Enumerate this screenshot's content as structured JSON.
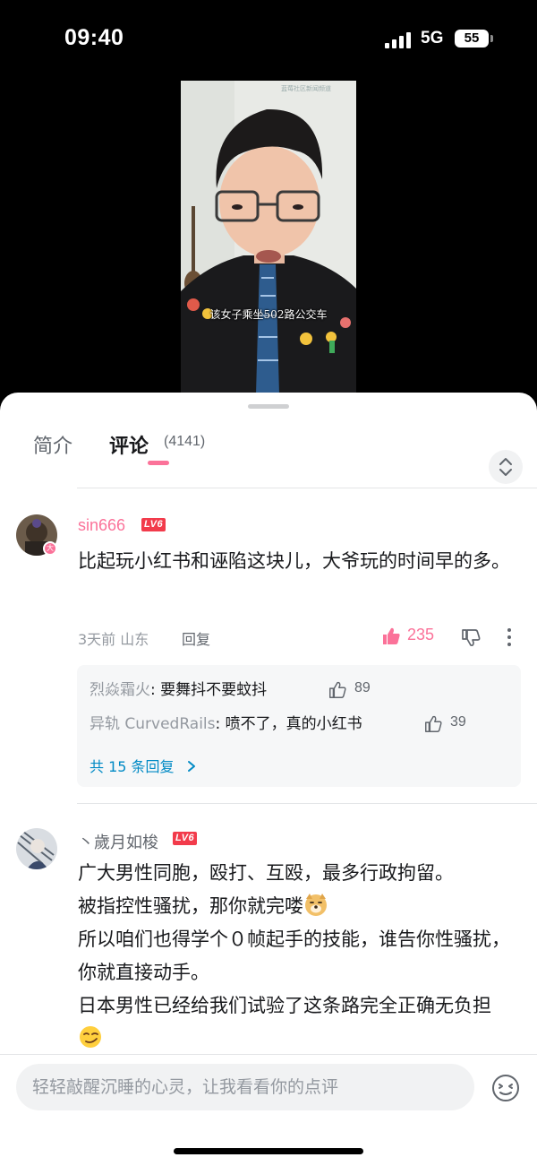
{
  "status_bar": {
    "time": "09:40",
    "network": "5G",
    "battery": "55"
  },
  "video": {
    "subtitle": "该女子乘坐502路公交车",
    "watermark": "蓝莓社区新闻频道"
  },
  "tabs": {
    "intro": "简介",
    "comments": "评论",
    "comment_count": "(4141)"
  },
  "comments": [
    {
      "username": "sin666",
      "level": "LV6",
      "text": "比起玩小红书和诬陷这块儿，大爷玩的时间早的多。",
      "time": "3天前",
      "location": "山东",
      "reply_label": "回复",
      "likes": "235",
      "replies": [
        {
          "user": "烈焱霜火",
          "text": ": 要舞抖不要蚊抖",
          "likes": "89"
        },
        {
          "user": "异轨 CurvedRails",
          "text": ": 喷不了，真的小红书",
          "likes": "39"
        }
      ],
      "replies_more": "共 15 条回复"
    },
    {
      "username": "丶歲月如梭",
      "level": "LV6",
      "lines": [
        "广大男性同胞，殴打、互殴，最多行政拘留。",
        "被指控性骚扰，那你就完喽",
        "所以咱们也得学个０帧起手的技能，谁告你性骚扰，你就直接动手。",
        "日本男性已经给我们试验了这条路完全正确无负担"
      ]
    }
  ],
  "input": {
    "placeholder": "轻轻敲醒沉睡的心灵，让我看看你的点评"
  },
  "colors": {
    "accent": "#fb7299",
    "link": "#008ac5",
    "level_badge": "#f23b4b"
  }
}
